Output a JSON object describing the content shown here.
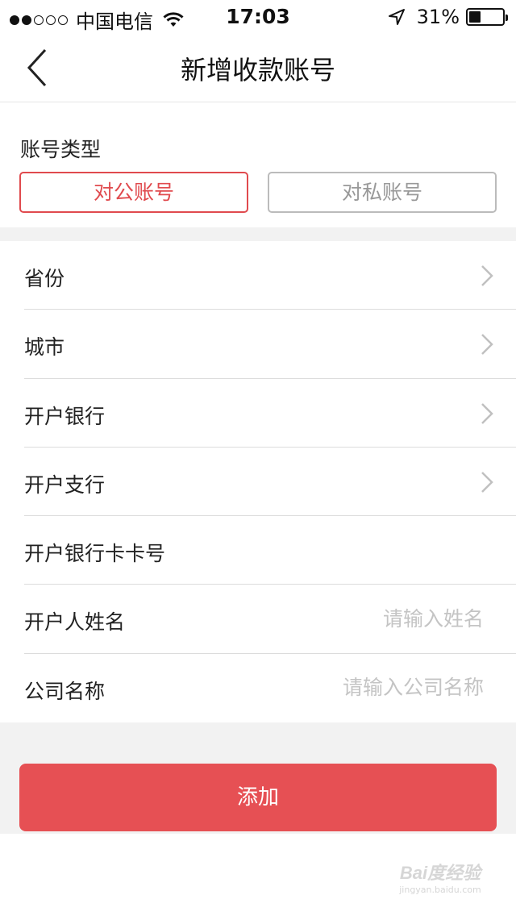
{
  "status_bar": {
    "carrier": "中国电信",
    "time": "17:03",
    "battery": "31%",
    "battery_level": 0.31
  },
  "nav": {
    "title": "新增收款账号",
    "back_icon": "chevron-left-icon"
  },
  "account_type": {
    "label": "账号类型",
    "options": [
      "对公账号",
      "对私账号"
    ],
    "selected": "对公账号"
  },
  "form": {
    "province": {
      "label": "省份",
      "icon": "chevron-right-icon"
    },
    "city": {
      "label": "城市",
      "icon": "chevron-right-icon"
    },
    "bank": {
      "label": "开户银行",
      "icon": "chevron-right-icon"
    },
    "branch": {
      "label": "开户支行",
      "icon": "chevron-right-icon"
    },
    "card_number": {
      "label": "开户银行卡卡号",
      "value": ""
    },
    "holder_name": {
      "label": "开户人姓名",
      "placeholder": "请输入姓名",
      "value": ""
    },
    "company_name": {
      "label": "公司名称",
      "placeholder": "请输入公司名称",
      "value": ""
    }
  },
  "submit": {
    "label": "添加"
  },
  "watermark": {
    "text": "Bai度经验",
    "sub": "jingyan.baidu.com"
  },
  "colors": {
    "accent": "#e04a4e",
    "button": "#e65054",
    "divider": "#dcdcdc",
    "background_gray": "#f2f2f2",
    "placeholder": "#c4c4c4"
  }
}
